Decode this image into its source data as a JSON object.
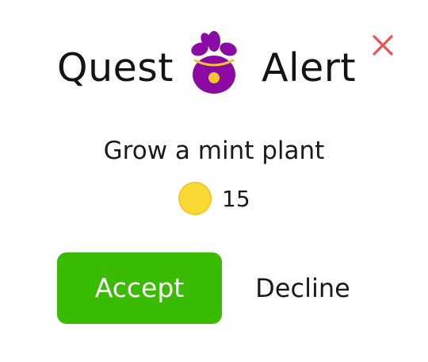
{
  "dialog": {
    "title_left": "Quest",
    "title_right": "Alert",
    "quest_text": "Grow a mint plant",
    "reward_amount": "15",
    "accept_label": "Accept",
    "decline_label": "Decline"
  },
  "icons": {
    "close": "close-icon",
    "mascot": "mascot-icon",
    "coin": "coin-icon"
  },
  "colors": {
    "accept_button": "#38bb00",
    "close_icon": "#f05050",
    "mascot_body": "#8a0aa3",
    "mascot_collar": "#f2c431",
    "coin": "#fbd935"
  }
}
